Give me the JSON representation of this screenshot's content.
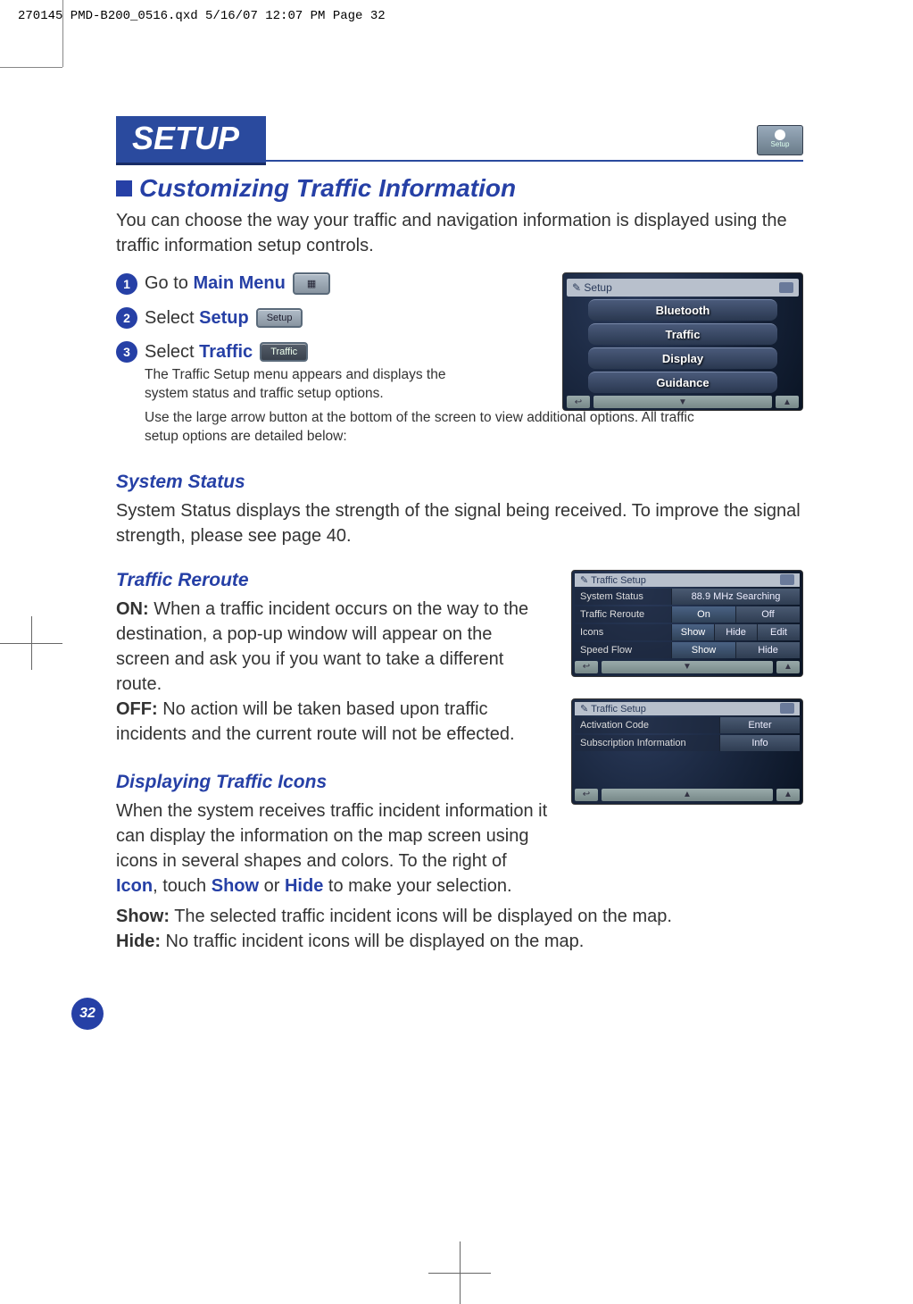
{
  "print_meta": "270145 PMD-B200_0516.qxd  5/16/07  12:07 PM  Page 32",
  "banner_title": "SETUP",
  "subtitle": "Customizing Traffic Information",
  "intro": "You can choose the way your traffic and navigation information is displayed using the traffic information setup controls.",
  "steps": {
    "s1": {
      "num": "1",
      "prefix": "Go to ",
      "kw": "Main Menu"
    },
    "s2": {
      "num": "2",
      "prefix": "Select ",
      "kw": "Setup",
      "btn_label": "Setup"
    },
    "s3": {
      "num": "3",
      "prefix": "Select ",
      "kw": "Traffic",
      "btn_label": "Traffic"
    },
    "note1": "The Traffic Setup menu appears and displays the system status and traffic setup options.",
    "note2": "Use the large arrow button at the bottom of the screen to view additional options. All traffic setup options are detailed below:"
  },
  "setup_screen": {
    "title": "Setup",
    "items": [
      "Bluetooth",
      "Traffic",
      "Display",
      "Guidance"
    ]
  },
  "system_status": {
    "heading": "System Status",
    "body": "System Status displays the strength of the signal being received. To improve the signal strength, please see page 40."
  },
  "traffic_reroute": {
    "heading": "Traffic Reroute",
    "on_label": "ON:",
    "on_text": " When a traffic incident occurs on the way to the destination, a pop-up window will appear on the screen and ask you if you want to take a different route.",
    "off_label": "OFF:",
    "off_text": " No action will be taken based upon traffic incidents and the current route will not be effected."
  },
  "icons_section": {
    "heading": "Displaying Traffic Icons",
    "p1_a": "When the system receives traffic incident information it can display the information on the map screen using icons in several shapes and colors. To the right of ",
    "kw_icon": "Icon",
    "p1_b": ", touch ",
    "kw_show": "Show",
    "p1_c": " or ",
    "kw_hide": "Hide",
    "p1_d": " to make your selection.",
    "show_label": "Show:",
    "show_text": " The selected traffic incident icons will be displayed on the map.",
    "hide_label": "Hide:",
    "hide_text": " No traffic incident icons will be displayed on the map."
  },
  "traffic_setup_screen1": {
    "title": "Traffic Setup",
    "rows": {
      "system_status": {
        "label": "System Status",
        "value": "88.9 MHz Searching"
      },
      "reroute": {
        "label": "Traffic Reroute",
        "on": "On",
        "off": "Off"
      },
      "icons": {
        "label": "Icons",
        "show": "Show",
        "hide": "Hide",
        "edit": "Edit"
      },
      "speed": {
        "label": "Speed Flow",
        "show": "Show",
        "hide": "Hide"
      }
    }
  },
  "traffic_setup_screen2": {
    "title": "Traffic Setup",
    "rows": {
      "activation": {
        "label": "Activation Code",
        "btn": "Enter"
      },
      "subscription": {
        "label": "Subscription Information",
        "btn": "Info"
      }
    }
  },
  "page_number": "32",
  "setup_icon_label": "Setup"
}
